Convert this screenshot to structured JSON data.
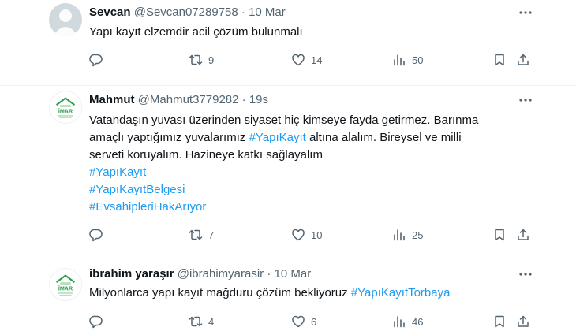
{
  "tweets": [
    {
      "name": "Sevcan",
      "handle": "@Sevcan07289758",
      "sep": "·",
      "time": "10 Mar",
      "lines": [
        "Yapı kayıt elzemdir acil çözüm bulunmalı"
      ],
      "hashtags": [],
      "replies": "",
      "retweets": "9",
      "likes": "14",
      "views": "50",
      "avatar": "gray-placeholder"
    },
    {
      "name": "Mahmut",
      "handle": "@Mahmut3779282",
      "sep": "·",
      "time": "19s",
      "line1": "Vatandaşın yuvası üzerinden siyaset hiç kimseye fayda getirmez. Barınma",
      "line2_pre": "amaçlı yaptığımız yuvalarımız ",
      "line2_tag": "#YapıKayıt",
      "line2_post": " altına alalım. Bireysel ve milli",
      "line3": "serveti koruyalım. Hazineye katkı sağlayalım",
      "hashtags": [
        "#YapıKayıt",
        "#YapıKayıtBelgesi",
        "#EvsahipleriHakArıyor"
      ],
      "replies": "",
      "retweets": "7",
      "likes": "10",
      "views": "25",
      "avatar": "imar-logo",
      "logo_text": "İMAR"
    },
    {
      "name": "ibrahim yaraşır",
      "handle": "@ibrahimyarasir",
      "sep": "·",
      "time": "10 Mar",
      "line_pre": "Milyonlarca yapı kayıt mağduru çözüm bekliyoruz ",
      "line_tag": "#YapıKayıtTorbaya",
      "replies": "",
      "retweets": "4",
      "likes": "6",
      "views": "46",
      "avatar": "imar-logo",
      "logo_text": "İMAR"
    }
  ],
  "colors": {
    "link": "#1d9bf0",
    "muted": "#536471",
    "text": "#0f1419",
    "divider": "#eff3f4",
    "logo_green": "#2e9e4a"
  }
}
